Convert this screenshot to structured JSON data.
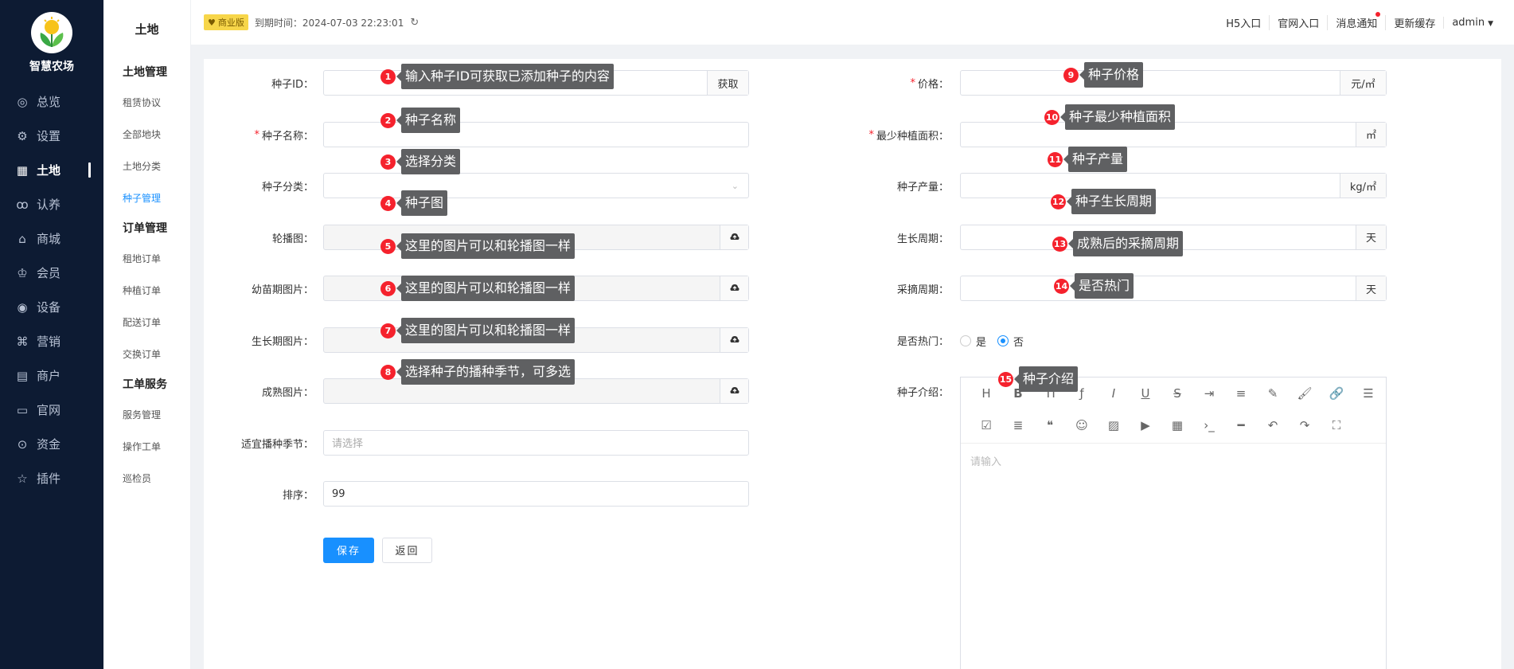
{
  "app": {
    "name": "智慧农场"
  },
  "nav": [
    {
      "label": "总览",
      "icon": "dashboard-icon"
    },
    {
      "label": "设置",
      "icon": "gear-icon"
    },
    {
      "label": "土地",
      "icon": "grid-icon",
      "active": true
    },
    {
      "label": "认养",
      "icon": "adopt-icon"
    },
    {
      "label": "商城",
      "icon": "shop-icon"
    },
    {
      "label": "会员",
      "icon": "member-icon"
    },
    {
      "label": "设备",
      "icon": "device-icon"
    },
    {
      "label": "营销",
      "icon": "marketing-icon"
    },
    {
      "label": "商户",
      "icon": "merchant-icon"
    },
    {
      "label": "官网",
      "icon": "website-icon"
    },
    {
      "label": "资金",
      "icon": "fund-icon"
    },
    {
      "label": "插件",
      "icon": "star-icon"
    }
  ],
  "submenu": {
    "title": "土地",
    "groups": [
      {
        "label": "土地管理",
        "items": [
          "租赁协议",
          "全部地块",
          "土地分类",
          "种子管理"
        ]
      },
      {
        "label": "订单管理",
        "items": [
          "租地订单",
          "种植订单",
          "配送订单",
          "交换订单"
        ]
      },
      {
        "label": "工单服务",
        "items": [
          "服务管理",
          "操作工单",
          "巡检员"
        ]
      }
    ],
    "active": "种子管理"
  },
  "topbar": {
    "badge": "商业版",
    "expire": "到期时间：2024-07-03 22:23:01",
    "links": [
      "H5入口",
      "官网入口",
      "消息通知",
      "更新缓存",
      "admin"
    ]
  },
  "form": {
    "left": [
      {
        "label": "种子ID：",
        "placeholder": "",
        "addon": "获取",
        "required": false
      },
      {
        "label": "种子名称：",
        "placeholder": "",
        "addon": "",
        "required": true
      },
      {
        "label": "种子分类：",
        "placeholder": "",
        "addon": "",
        "required": false,
        "select": true
      },
      {
        "label": "轮播图：",
        "placeholder": "",
        "addon": "upload",
        "required": false,
        "gray": true
      },
      {
        "label": "幼苗期图片：",
        "placeholder": "",
        "addon": "upload",
        "required": false,
        "gray": true
      },
      {
        "label": "生长期图片：",
        "placeholder": "",
        "addon": "upload",
        "required": false,
        "gray": true
      },
      {
        "label": "成熟图片：",
        "placeholder": "",
        "addon": "upload",
        "required": false,
        "gray": true
      },
      {
        "label": "适宜播种季节：",
        "placeholder": "请选择",
        "addon": "",
        "required": false
      },
      {
        "label": "排序：",
        "value": "99",
        "addon": "",
        "required": false
      }
    ],
    "right": [
      {
        "label": "价格：",
        "addon": "元/㎡",
        "required": true
      },
      {
        "label": "最少种植面积：",
        "addon": "㎡",
        "required": true
      },
      {
        "label": "种子产量：",
        "addon": "kg/㎡",
        "required": false
      },
      {
        "label": "生长周期：",
        "addon": "天",
        "required": false
      },
      {
        "label": "采摘周期：",
        "addon": "天",
        "required": false
      }
    ],
    "hot": {
      "label": "是否热门：",
      "yes": "是",
      "no": "否",
      "selected": "否"
    },
    "intro": {
      "label": "种子介绍：",
      "placeholder": "请输入"
    },
    "buttons": {
      "save": "保存",
      "back": "返回"
    }
  },
  "tips": [
    {
      "n": "1",
      "text": "输入种子ID可获取已添加种子的内容"
    },
    {
      "n": "2",
      "text": "种子名称"
    },
    {
      "n": "3",
      "text": "选择分类"
    },
    {
      "n": "4",
      "text": "种子图"
    },
    {
      "n": "5",
      "text": "这里的图片可以和轮播图一样"
    },
    {
      "n": "6",
      "text": "这里的图片可以和轮播图一样"
    },
    {
      "n": "7",
      "text": "这里的图片可以和轮播图一样"
    },
    {
      "n": "8",
      "text": "选择种子的播种季节，可多选"
    },
    {
      "n": "9",
      "text": "种子价格"
    },
    {
      "n": "10",
      "text": "种子最少种植面积"
    },
    {
      "n": "11",
      "text": "种子产量"
    },
    {
      "n": "12",
      "text": "种子生长周期"
    },
    {
      "n": "13",
      "text": "成熟后的采摘周期"
    },
    {
      "n": "14",
      "text": "是否热门"
    },
    {
      "n": "15",
      "text": "种子介绍"
    }
  ],
  "colors": {
    "sidebar": "#0d1b33",
    "primary": "#1890ff",
    "tip": "#5f6062",
    "marker": "#f5222d"
  }
}
